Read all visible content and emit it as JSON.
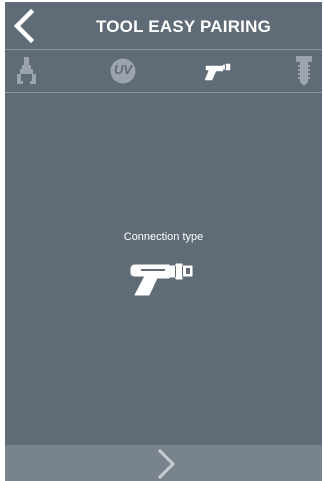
{
  "header": {
    "title": "TOOL EASY PAIRING",
    "back_icon": "chevron-left-icon"
  },
  "toolbar": {
    "items": [
      {
        "icon": "robot-arm-icon",
        "state": "inactive"
      },
      {
        "icon": "uv-icon",
        "label": "UV",
        "state": "inactive"
      },
      {
        "icon": "drill-icon",
        "state": "active"
      },
      {
        "icon": "screw-icon",
        "state": "inactive"
      }
    ]
  },
  "main": {
    "connection_label": "Connection type",
    "connection_icon": "drill-icon"
  },
  "footer": {
    "next_icon": "chevron-right-icon"
  },
  "colors": {
    "background": "#5f6b76",
    "footer": "#78838e",
    "inactive_icon": "#9ba4ad",
    "active_icon": "#ffffff"
  }
}
